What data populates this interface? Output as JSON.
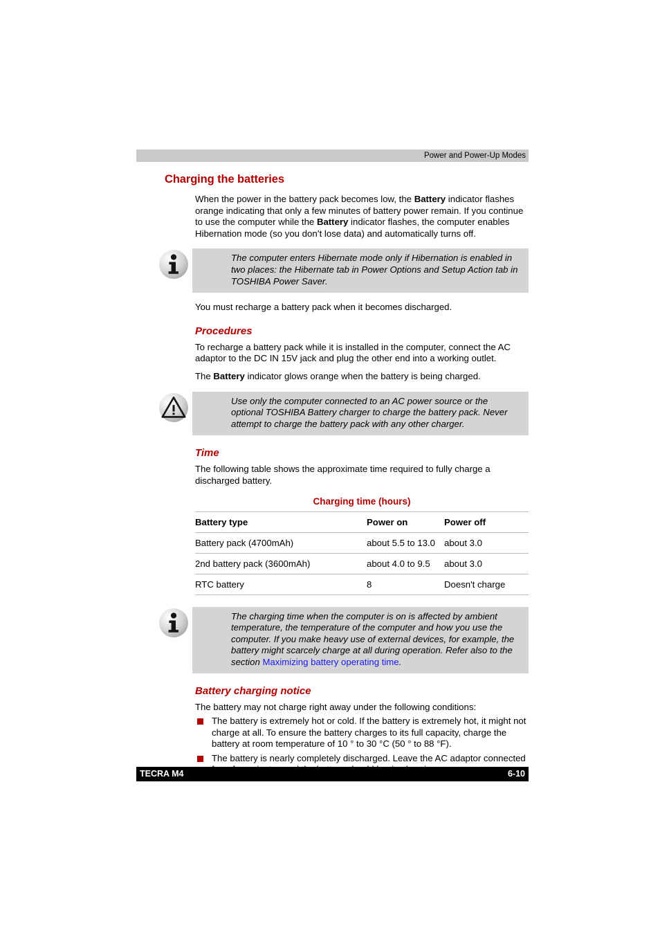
{
  "header": {
    "running_title": "Power and Power-Up Modes"
  },
  "sections": {
    "heading": "Charging the batteries",
    "intro": {
      "part1": "When the power in the battery pack becomes low, the ",
      "bold1": "Battery",
      "part2": " indicator flashes orange indicating that only a few minutes of battery power remain. If you continue to use the computer while the ",
      "bold2": "Battery",
      "part3": " indicator flashes, the computer enables Hibernation mode (so you don’t lose data) and automatically turns off."
    },
    "note1": "The computer enters Hibernate mode only if Hibernation is enabled in two places: the Hibernate tab in Power Options and Setup Action tab in TOSHIBA Power Saver.",
    "after_note1": "You must recharge a battery pack when it becomes discharged.",
    "procedures": {
      "heading": "Procedures",
      "para1": "To recharge a battery pack while it is installed in the computer, connect the AC adaptor to the DC IN 15V jack and plug the other end into a working outlet.",
      "para2_part1": "The ",
      "para2_bold": "Battery",
      "para2_part2": " indicator glows orange when the battery is being charged."
    },
    "warning": "Use only the computer connected to an AC power source or the optional TOSHIBA Battery charger to charge the battery pack. Never attempt to charge the battery pack with any other charger.",
    "time": {
      "heading": "Time",
      "para": "The following table shows the approximate time required to fully charge a discharged battery."
    },
    "note2": {
      "part1": "The charging time when the computer is on is affected by ambient temperature, the temperature of the computer and how you use the computer. If you make heavy use of external devices, for example, the battery might scarcely charge at all during operation. Refer also to the section ",
      "link": "Maximizing battery operating time",
      "part2": "."
    },
    "notice": {
      "heading": "Battery charging notice",
      "intro": "The battery may not charge right away under the following conditions:",
      "bullets": [
        "The battery is extremely hot or cold. If the battery is extremely hot, it might not charge at all. To ensure the battery charges to its full capacity, charge the battery at room temperature of 10 ° to 30 °C (50 ° to 88 °F).",
        "The battery is nearly completely discharged. Leave the AC adaptor connected for a few minutes and the battery should begin charging."
      ]
    }
  },
  "table": {
    "title": "Charging time (hours)",
    "columns": [
      "Battery type",
      "Power on",
      "Power off"
    ],
    "rows": [
      [
        "Battery pack (4700mAh)",
        "about 5.5 to 13.0",
        "about 3.0"
      ],
      [
        "2nd battery pack (3600mAh)",
        "about 4.0 to 9.5",
        "about 3.0"
      ],
      [
        "RTC battery",
        "8",
        "Doesn't charge"
      ]
    ]
  },
  "footer": {
    "model": "TECRA M4",
    "page_number": "6-10"
  },
  "colors": {
    "heading_red": "#b00000",
    "callout_bg": "#d4d4d4",
    "header_bar_bg": "#c9c9c9",
    "link_blue": "#1a1aee",
    "footer_bg": "#000000"
  },
  "icons": {
    "info": "info-icon",
    "warning": "warning-icon"
  }
}
